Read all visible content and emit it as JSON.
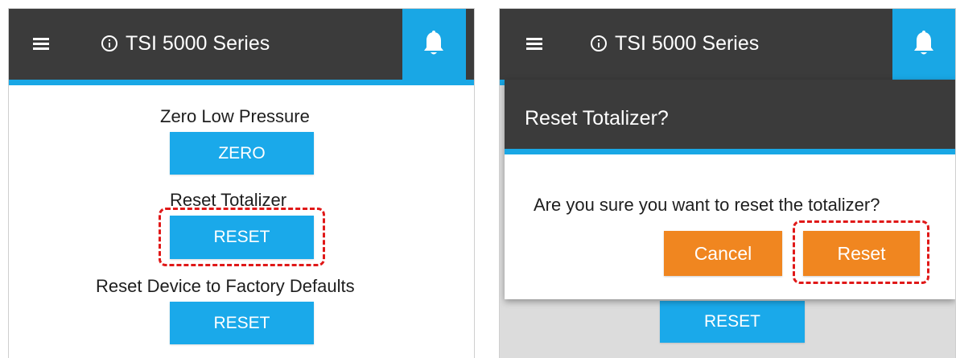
{
  "left_screen": {
    "header": {
      "title": "TSI 5000 Series"
    },
    "sections": [
      {
        "label": "Zero Low Pressure",
        "button": "ZERO"
      },
      {
        "label": "Reset Totalizer",
        "button": "RESET",
        "highlighted": true
      },
      {
        "label": "Reset Device to Factory Defaults",
        "button": "RESET"
      }
    ]
  },
  "right_screen": {
    "header": {
      "title": "TSI 5000 Series"
    },
    "dialog": {
      "title": "Reset Totalizer?",
      "message": "Are you sure you want to reset the totalizer?",
      "cancel_label": "Cancel",
      "confirm_label": "Reset",
      "confirm_highlighted": true
    },
    "background_button": "RESET"
  },
  "colors": {
    "header_bg": "#3b3b3b",
    "accent_blue": "#19a7e5",
    "button_blue": "#1aa9ea",
    "orange": "#f08620",
    "highlight_red": "#e01818"
  },
  "icons": [
    "hamburger-menu-icon",
    "info-icon",
    "bell-icon"
  ]
}
